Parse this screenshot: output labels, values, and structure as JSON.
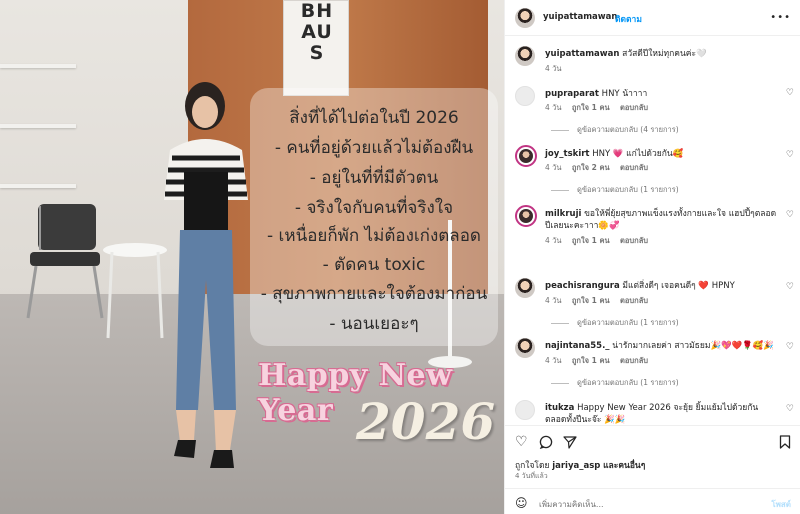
{
  "post_image": {
    "poster_text": "BH\nAU\nS",
    "lines": [
      "สิ่งที่ได้ไปต่อในปี 2026",
      "- คนที่อยู่ด้วยแล้วไม่ต้องฝืน",
      "- อยู่ในที่ที่มีตัวตน",
      "- จริงใจกับคนที่จริงใจ",
      "- เหนื่อยก็พัก ไม่ต้องเก่งตลอด",
      "- ตัดคน toxic",
      "- สุขภาพกายและใจต้องมาก่อน",
      "- นอนเยอะๆ"
    ],
    "greeting": "Happy New Year",
    "year": "2026"
  },
  "header": {
    "username": "yuipattamawan",
    "dot": "•",
    "follow_label": "ติดตาม",
    "more_icon": "more-horizontal-icon"
  },
  "caption": {
    "username": "yuipattamawan",
    "text": "สวัสดีปีใหม่ทุกคนค่ะ🤍",
    "time": "4 วัน"
  },
  "comments": [
    {
      "username": "pupraparat",
      "text": "HNY น้าาาา",
      "time": "4 วัน",
      "likes": "ถูกใจ 1 คน",
      "reply": "ตอบกลับ",
      "view_replies": "ดูข้อความตอบกลับ (4 รายการ)"
    },
    {
      "username": "joy_tskirt",
      "text": "HNY 💗 แก่ไปด้วยกัน🥰",
      "time": "4 วัน",
      "likes": "ถูกใจ 2 คน",
      "reply": "ตอบกลับ",
      "view_replies": "ดูข้อความตอบกลับ (1 รายการ)"
    },
    {
      "username": "milkruji",
      "text": "ขอให้พี่ยุ้ยสุขภาพแข็งแรงทั้งกายและใจ แฮปปี้ๆตลอดปีเลยนะคะาาา🌼💞",
      "time": "4 วัน",
      "likes": "ถูกใจ 1 คน",
      "reply": "ตอบกลับ",
      "view_replies": ""
    },
    {
      "username": "peachisrangura",
      "text": "มีแต่สิ่งดีๆ เจอคนดีๆ ❤️ HPNY",
      "time": "4 วัน",
      "likes": "ถูกใจ 1 คน",
      "reply": "ตอบกลับ",
      "view_replies": "ดูข้อความตอบกลับ (1 รายการ)"
    },
    {
      "username": "najintana55._",
      "text": "น่ารักมากเลยค่า สาวมัธยม🎉💖❤️🌹🥰🎉",
      "time": "4 วัน",
      "likes": "ถูกใจ 1 คน",
      "reply": "ตอบกลับ",
      "view_replies": "ดูข้อความตอบกลับ (1 รายการ)"
    },
    {
      "username": "itukza",
      "text": "Happy New Year 2026 จะยุ้ย ยิ้มแย้มไปด้วยกันตลอดทั้งปีนะจ๊ะ 🎉🎉",
      "time": "",
      "likes": "",
      "reply": "",
      "view_replies": ""
    }
  ],
  "actions": {
    "like_icon": "heart-icon",
    "comment_icon": "comment-icon",
    "share_icon": "send-icon",
    "save_icon": "bookmark-icon",
    "liked_by_prefix": "ถูกใจโดย",
    "liked_by_user": "jariya_asp",
    "liked_by_suffix": "และคนอื่นๆ",
    "ago": "4 วันที่แล้ว"
  },
  "add_comment": {
    "emoji_icon": "smiley-icon",
    "placeholder": "เพิ่มความคิดเห็น...",
    "post_label": "โพสต์"
  },
  "colors": {
    "link": "#0095f6",
    "post_disabled": "#b2dffc",
    "text": "#262626",
    "muted": "#737373"
  }
}
